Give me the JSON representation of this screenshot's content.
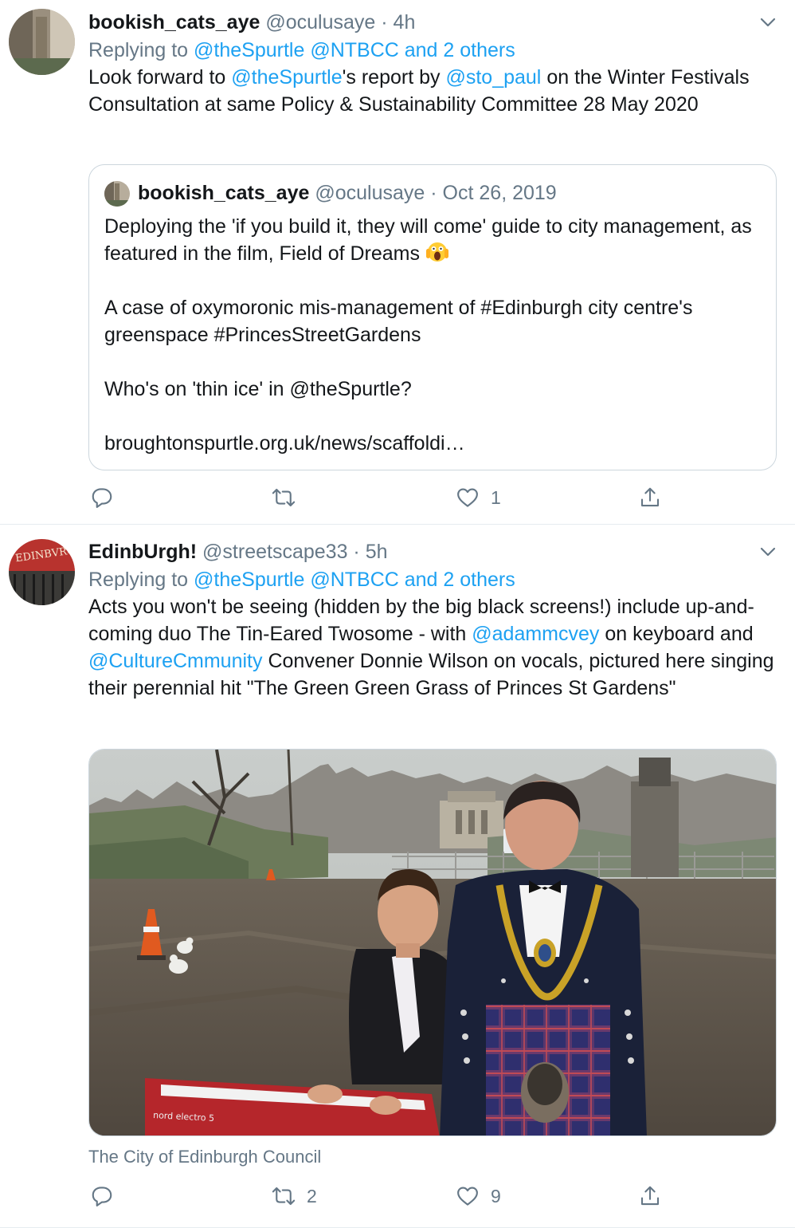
{
  "tweets": [
    {
      "display_name": "bookish_cats_aye",
      "handle": "@oculusaye",
      "separator": "·",
      "time": "4h",
      "replying_prefix": "Replying to",
      "replying_links": "@theSpurtle @NTBCC and 2 others",
      "body": {
        "t1": "Look forward to",
        "m1": "@theSpurtle",
        "t2": "'s report by",
        "m2": "@sto_paul",
        "t3": "on the Winter Festivals Consultation at same Policy & Sustainability Committee 28 May 2020"
      },
      "quote": {
        "display_name": "bookish_cats_aye",
        "handle": "@oculusaye",
        "separator": "·",
        "date": "Oct 26, 2019",
        "lines": [
          "Deploying the 'if you build it, they will come' guide to city management, as featured in the film, Field of Dreams",
          "",
          "A case of oxymoronic mis-management of #Edinburgh city centre's greenspace #PrincesStreetGardens",
          "",
          "Who's on 'thin ice' in @theSpurtle?",
          "",
          "broughtonspurtle.org.uk/news/scaffoldi…"
        ],
        "emoji": "screaming-face-emoji"
      },
      "actions": {
        "reply": "",
        "retweet": "",
        "like": "1",
        "share": ""
      }
    },
    {
      "display_name": "EdinbUrgh!",
      "handle": "@streetscape33",
      "separator": "·",
      "time": "5h",
      "replying_prefix": "Replying to",
      "replying_links": "@theSpurtle @NTBCC and 2 others",
      "body": {
        "t1": "Acts you won't be seeing (hidden by the big black screens!) include up-and-coming duo The Tin-Eared Twosome - with",
        "m1": "@adammcvey",
        "t2": "on keyboard and",
        "m2": "@CultureCmmunity",
        "t3": "Convener Donnie Wilson on vocals, pictured here singing their perennial hit \"The Green Green Grass of Princes St Gardens\""
      },
      "media_caption": "The City of Edinburgh Council",
      "media_keyboard_label": "nord electro 5",
      "avatar_sign_text": "EDINBVRG",
      "actions": {
        "reply": "",
        "retweet": "2",
        "like": "9",
        "share": ""
      }
    }
  ],
  "colors": {
    "link": "#1da1f2",
    "muted": "#657786",
    "text": "#14171a",
    "border": "#ccd6dd"
  },
  "icons": [
    "reply-icon",
    "retweet-icon",
    "like-icon",
    "share-icon",
    "chevron-down-icon"
  ]
}
